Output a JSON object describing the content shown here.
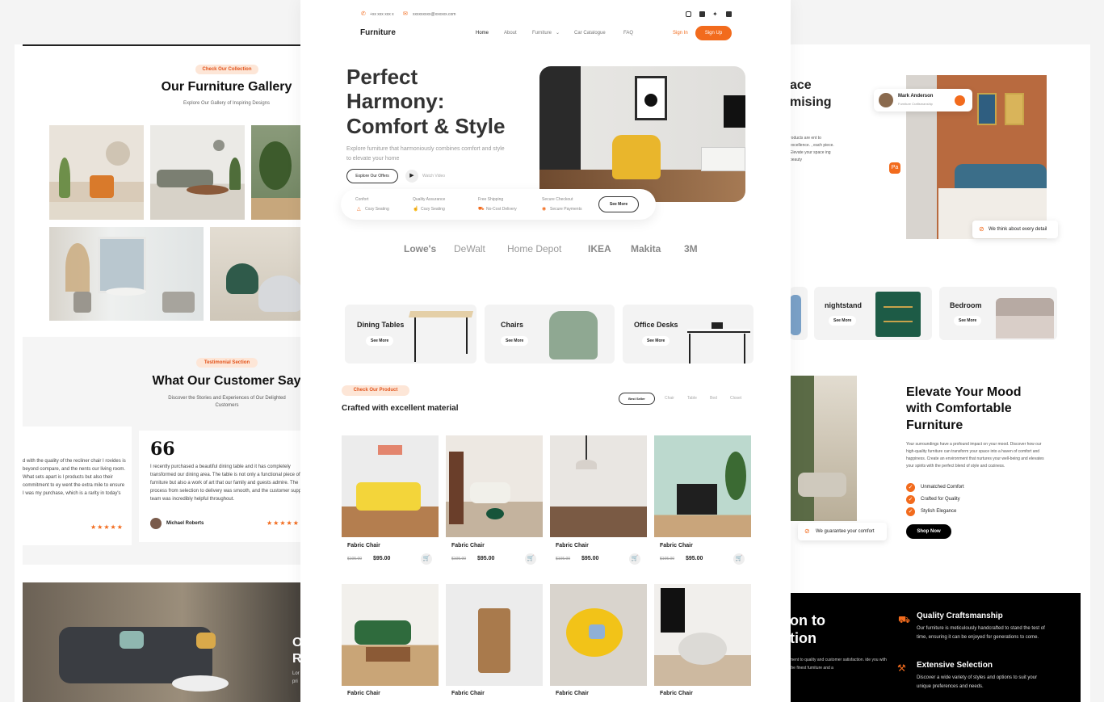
{
  "left": {
    "gallery_pill": "Check Our Collection",
    "gallery_title": "Our Furniture Gallery",
    "gallery_sub": "Explore Our Gallery of Inspiring Designs",
    "testi_pill": "Testimonial Section",
    "testi_title": "What Our Customer Say",
    "testi_sub": "Discover the Stories and Experiences of Our Delighted Customers",
    "quote_left": "d with the quality of the recliner chair I rovides is beyond compare, and the nents our living room. What sets apart is l products but also their commitment to ey went the extra mile to ensure I was my purchase, which is a rarity in today's",
    "quote_main": "I recently purchased a beautiful dining table and it has completely transformed our dining area. The table is not only a functional piece of furniture but also a work of art that our family and guests admire. The process from selection to delivery was smooth, and the customer support team was incredibly helpful throughout.",
    "quote_glyph": "66",
    "reviewer": "Michael Roberts",
    "stars": "★★★★★",
    "bottom_text": [
      "O",
      "R"
    ],
    "bottom_small": [
      "Lor",
      "pri"
    ]
  },
  "center": {
    "phone": "+xx xxx xxx x",
    "email": "xxxxxxxxx@xxxxxx.com",
    "brand": "Furniture",
    "nav": [
      "Home",
      "About",
      "Furniture",
      "Car Catalogue",
      "FAQ"
    ],
    "signin": "Sign In",
    "signup": "Sign Up",
    "hero_title": [
      "Perfect",
      "Harmony:",
      "Comfort & Style"
    ],
    "hero_desc": "Explore furniture that harmoniously combines comfort and style to elevate your home",
    "explore_btn": "Explore Our Offers",
    "watch": "Watch Video",
    "features": [
      {
        "title": "Confort",
        "sub": "Cozy Seating"
      },
      {
        "title": "Quality Assurance",
        "sub": "Cozy Seating"
      },
      {
        "title": "Free Shipping",
        "sub": "No-Cost Delivery"
      },
      {
        "title": "Secure Checkout",
        "sub": "Secure Payments"
      }
    ],
    "see_more": "See More",
    "brands": [
      "Lowe's",
      "DeWalt",
      "Home Depot",
      "IKEA",
      "Makita",
      "3M"
    ],
    "categories": [
      {
        "name": "Dining Tables",
        "btn": "See More"
      },
      {
        "name": "Chairs",
        "btn": "See More"
      },
      {
        "name": "Office Desks",
        "btn": "See More"
      }
    ],
    "product_pill": "Check Our Product",
    "product_title": "Crafted with excellent material",
    "filters": [
      "Best Seller",
      "Chair",
      "Table",
      "Bed",
      "Closet"
    ],
    "products": [
      {
        "name": "Fabric Chair",
        "old": "$105.00",
        "price": "$95.00"
      },
      {
        "name": "Fabric Chair",
        "old": "$105.00",
        "price": "$95.00"
      },
      {
        "name": "Fabric Chair",
        "old": "$105.00",
        "price": "$95.00"
      },
      {
        "name": "Fabric Chair",
        "old": "$105.00",
        "price": "$95.00"
      }
    ],
    "products2": [
      "Fabric Chair",
      "Fabric Chair",
      "Fabric Chair",
      "Fabric Chair"
    ]
  },
  "right": {
    "title_frag": [
      "ace",
      "mising"
    ],
    "desc_frag": "roducts are ent to excellence. , each piece. Elevate your space ing beauty",
    "user": "Mark Anderson",
    "user_role": "Furniture Craftsmanship",
    "detail_badge": "We think about every detail",
    "cats": [
      {
        "name": "nightstand",
        "btn": "See More"
      },
      {
        "name": "Bedroom",
        "btn": "See More"
      }
    ],
    "mood_title": [
      "Elevate Your Mood",
      "with Comfortable",
      "Furniture"
    ],
    "mood_desc": "Your surroundings have a profound impact on your mood. Discover how our high-quality furniture can transform your space into a haven of comfort and happiness. Create an environment that nurtures your well-being and elevates your spirits with the perfect blend of style and coziness.",
    "checks": [
      "Unmatched Comfort",
      "Crafted for Quality",
      "Stylish Elegance"
    ],
    "shop_btn": "Shop Now",
    "guarantee": "We guarantee your comfort",
    "dark_title": [
      "on to",
      "tion"
    ],
    "dark_small": "ment to quality and customer satisfaction. ide you with the finest furniture and a",
    "feat1_title": "Quality Craftsmanship",
    "feat1_desc": "Our furniture is meticulously handcrafted to stand the test of time, ensuring it can be enjoyed for generations to come.",
    "feat2_title": "Extensive Selection",
    "feat2_desc": "Discover a wide variety of styles and options to suit your unique preferences and needs."
  },
  "colors": {
    "accent": "#f26b1d",
    "dark": "#000000",
    "panel": "#f5f5f5"
  }
}
